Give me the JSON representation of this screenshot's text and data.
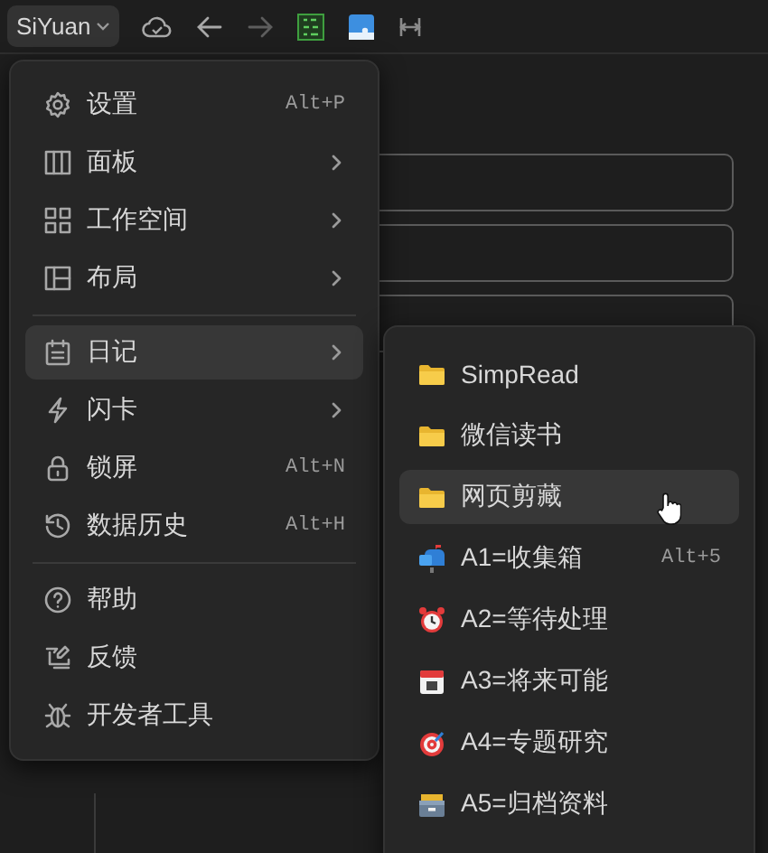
{
  "toolbar": {
    "workspace": "SiYuan",
    "back_disabled": false,
    "forward_disabled": true
  },
  "menu": {
    "groups": [
      [
        {
          "kind": "gear",
          "label": "设置",
          "shortcut": "Alt+P",
          "submenu": false,
          "selected": false
        },
        {
          "kind": "columns",
          "label": "面板",
          "submenu": true,
          "selected": false
        },
        {
          "kind": "grid",
          "label": "工作空间",
          "submenu": true,
          "selected": false
        },
        {
          "kind": "layout",
          "label": "布局",
          "submenu": true,
          "selected": false
        }
      ],
      [
        {
          "kind": "calendar",
          "label": "日记",
          "submenu": true,
          "selected": true
        },
        {
          "kind": "bolt",
          "label": "闪卡",
          "submenu": true,
          "selected": false
        },
        {
          "kind": "lock",
          "label": "锁屏",
          "shortcut": "Alt+N",
          "submenu": false,
          "selected": false
        },
        {
          "kind": "history",
          "label": "数据历史",
          "shortcut": "Alt+H",
          "submenu": false,
          "selected": false
        }
      ],
      [
        {
          "kind": "help",
          "label": "帮助",
          "submenu": false,
          "selected": false
        },
        {
          "kind": "feedback",
          "label": "反馈",
          "submenu": false,
          "selected": false
        },
        {
          "kind": "bug",
          "label": "开发者工具",
          "submenu": false,
          "selected": false
        }
      ]
    ]
  },
  "submenu": {
    "items": [
      {
        "kind": "folder",
        "label": "SimpRead",
        "selected": false
      },
      {
        "kind": "folder",
        "label": "微信读书",
        "selected": false
      },
      {
        "kind": "folder",
        "label": "网页剪藏",
        "selected": true
      },
      {
        "kind": "mailbox",
        "label": "A1=收集箱",
        "shortcut": "Alt+5",
        "selected": false
      },
      {
        "kind": "alarm",
        "label": "A2=等待处理",
        "selected": false
      },
      {
        "kind": "calendar",
        "label": "A3=将来可能",
        "selected": false
      },
      {
        "kind": "target",
        "label": "A4=专题研究",
        "selected": false
      },
      {
        "kind": "cardbox",
        "label": "A5=归档资料",
        "selected": false
      }
    ]
  }
}
